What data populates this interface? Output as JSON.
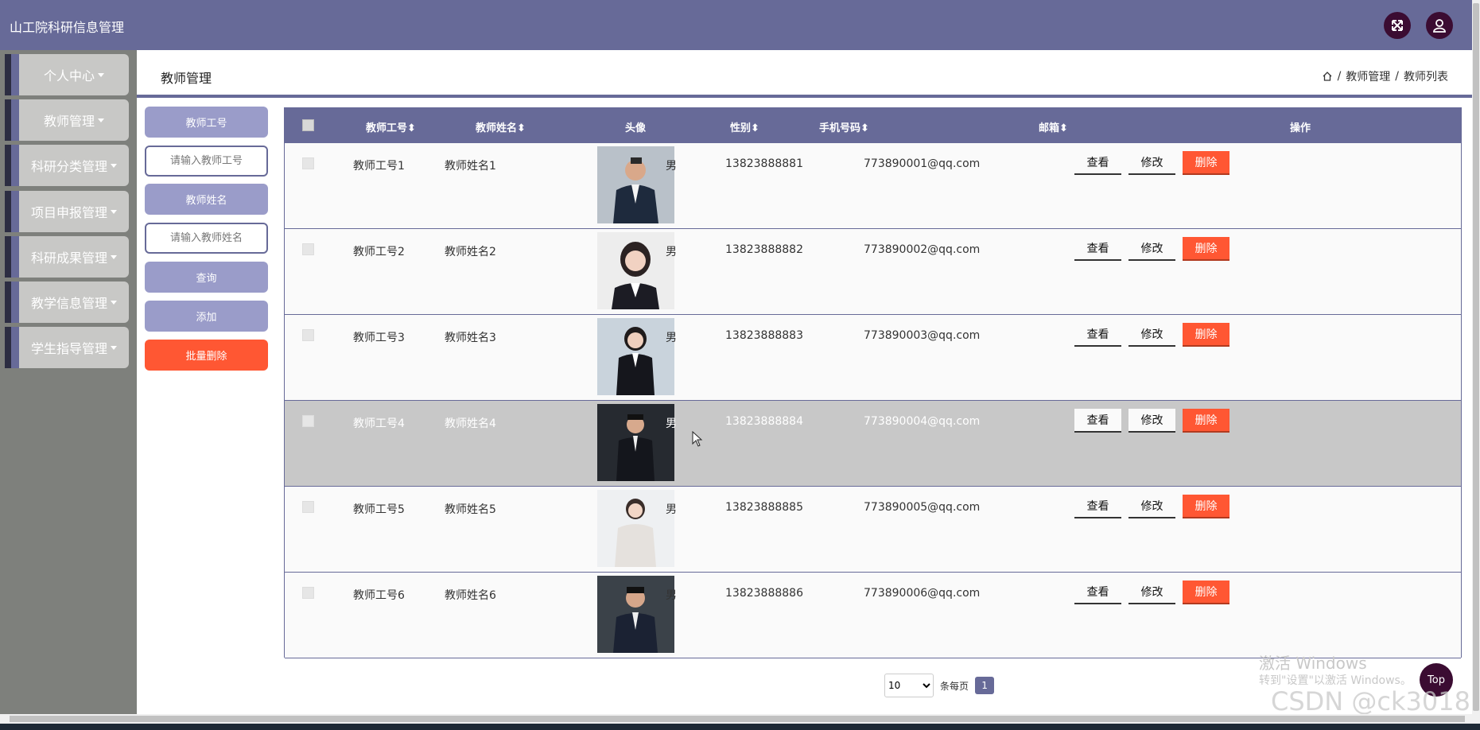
{
  "app": {
    "title": "山工院科研信息管理"
  },
  "header": {
    "fullscreen_icon": "expand-arrows-icon",
    "user_icon": "user-icon"
  },
  "sidebar": {
    "items": [
      {
        "label": "个人中心"
      },
      {
        "label": "教师管理"
      },
      {
        "label": "科研分类管理"
      },
      {
        "label": "项目申报管理"
      },
      {
        "label": "科研成果管理"
      },
      {
        "label": "教学信息管理"
      },
      {
        "label": "学生指导管理"
      }
    ]
  },
  "page": {
    "title": "教师管理",
    "breadcrumb": {
      "separator": "/",
      "items": [
        "教师管理",
        "教师列表"
      ]
    }
  },
  "search": {
    "id_label": "教师工号",
    "id_placeholder": "请输入教师工号",
    "name_label": "教师姓名",
    "name_placeholder": "请输入教师姓名",
    "query_label": "查询",
    "add_label": "添加",
    "batch_delete_label": "批量删除"
  },
  "table": {
    "columns": [
      "教师工号",
      "教师姓名",
      "头像",
      "性别",
      "手机号码",
      "邮箱",
      "操作"
    ],
    "sort_glyph": "⬍",
    "actions": {
      "view": "查看",
      "edit": "修改",
      "delete": "删除"
    },
    "rows": [
      {
        "id": "教师工号1",
        "name": "教师姓名1",
        "gender": "男",
        "phone": "13823888881",
        "email": "773890001@qq.com"
      },
      {
        "id": "教师工号2",
        "name": "教师姓名2",
        "gender": "男",
        "phone": "13823888882",
        "email": "773890002@qq.com"
      },
      {
        "id": "教师工号3",
        "name": "教师姓名3",
        "gender": "男",
        "phone": "13823888883",
        "email": "773890003@qq.com"
      },
      {
        "id": "教师工号4",
        "name": "教师姓名4",
        "gender": "男",
        "phone": "13823888884",
        "email": "773890004@qq.com"
      },
      {
        "id": "教师工号5",
        "name": "教师姓名5",
        "gender": "男",
        "phone": "13823888885",
        "email": "773890005@qq.com"
      },
      {
        "id": "教师工号6",
        "name": "教师姓名6",
        "gender": "男",
        "phone": "13823888886",
        "email": "773890006@qq.com"
      }
    ]
  },
  "pagination": {
    "page_size": "10",
    "per_page_label": "条每页",
    "current_page": "1"
  },
  "top_button": "Top",
  "watermark": {
    "line1": "激活 Windows",
    "line2": "转到\"设置\"以激活 Windows。",
    "csdn": "CSDN @ck3018"
  },
  "colors": {
    "primary": "#676a98",
    "danger": "#ff5733",
    "dark": "#3b0c32",
    "sidebar_bg": "#7e807c"
  }
}
